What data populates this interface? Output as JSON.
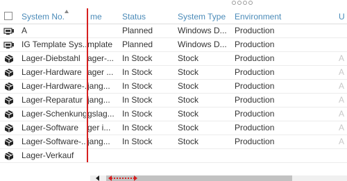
{
  "colors": {
    "header_text": "#4a8ab8",
    "frozen_divider": "#d62020",
    "grid_line": "#ececec"
  },
  "columns": {
    "system_no": "System No.",
    "name_partial": "me",
    "status": "Status",
    "system_type": "System Type",
    "environment": "Environment",
    "u_partial": "U"
  },
  "rows": [
    {
      "icon": "computer-icon",
      "system_no": "A",
      "name": "",
      "status": "Planned",
      "system_type": "Windows D...",
      "environment": "Production",
      "u": ""
    },
    {
      "icon": "computer-icon",
      "system_no": "IG Template Sys...",
      "name": "mplate",
      "status": "Planned",
      "system_type": "Windows D...",
      "environment": "Production",
      "u": ""
    },
    {
      "icon": "package-icon",
      "system_no": "Lager-Diebstahl",
      "name": "ager-...",
      "status": "In Stock",
      "system_type": "Stock",
      "environment": "Production",
      "u": "A"
    },
    {
      "icon": "package-icon",
      "system_no": "Lager-Hardware",
      "name": "ager ...",
      "status": "In Stock",
      "system_type": "Stock",
      "environment": "Production",
      "u": "A"
    },
    {
      "icon": "package-icon",
      "system_no": "Lager-Hardware-...",
      "name": "jang...",
      "status": "In Stock",
      "system_type": "Stock",
      "environment": "Production",
      "u": "A"
    },
    {
      "icon": "package-icon",
      "system_no": "Lager-Reparatur",
      "name": "jang...",
      "status": "In Stock",
      "system_type": "Stock",
      "environment": "Production",
      "u": "A"
    },
    {
      "icon": "package-icon",
      "system_no": "Lager-Schenkung",
      "name": "gslag...",
      "status": "In Stock",
      "system_type": "Stock",
      "environment": "Production",
      "u": "A"
    },
    {
      "icon": "package-icon",
      "system_no": "Lager-Software",
      "name": "ger i...",
      "status": "In Stock",
      "system_type": "Stock",
      "environment": "Production",
      "u": "A"
    },
    {
      "icon": "package-icon",
      "system_no": "Lager-Software-...",
      "name": "jang...",
      "status": "In Stock",
      "system_type": "Stock",
      "environment": "Production",
      "u": "A"
    },
    {
      "icon": "package-icon",
      "system_no": "Lager-Verkauf",
      "name": "",
      "status": "",
      "system_type": "",
      "environment": "",
      "u": ""
    }
  ]
}
